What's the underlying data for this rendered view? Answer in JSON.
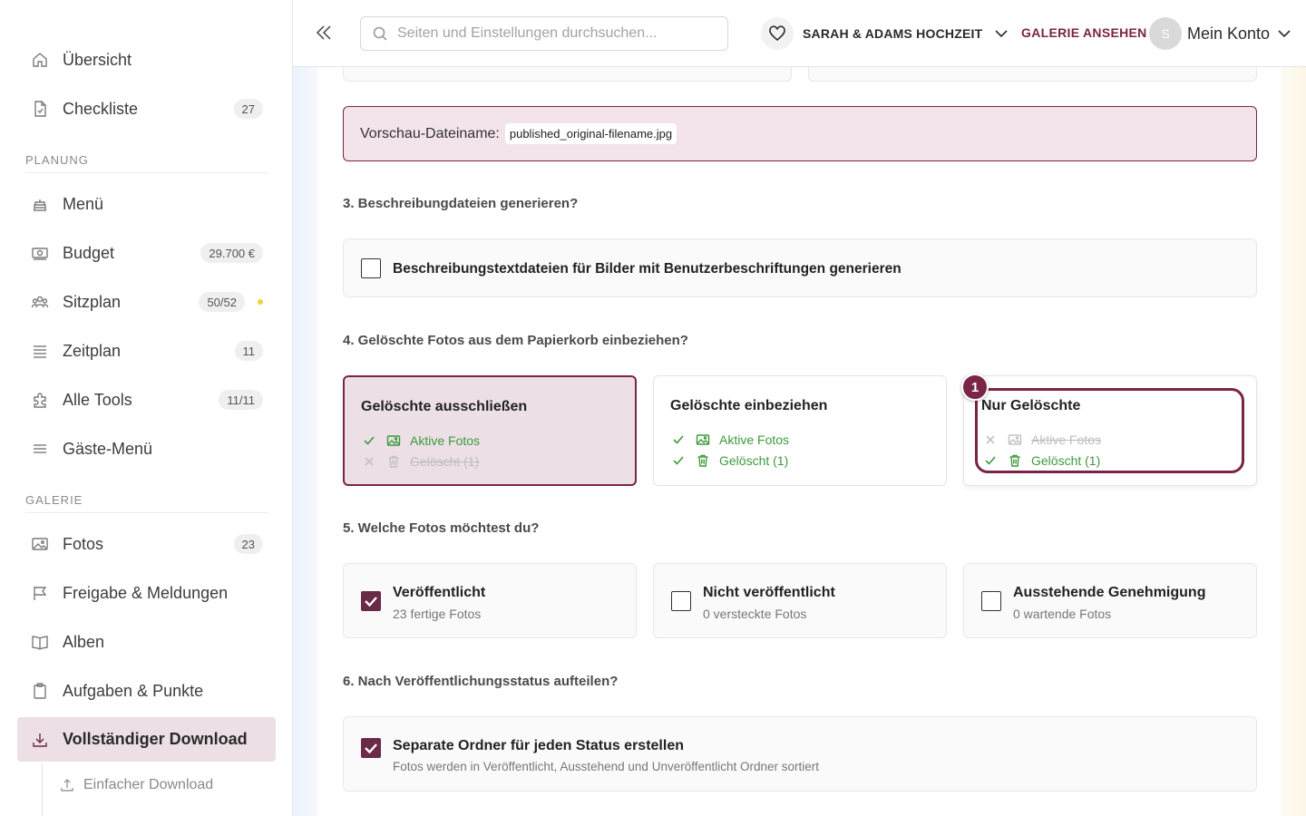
{
  "sidebar": {
    "items": [
      {
        "label": "Übersicht"
      },
      {
        "label": "Checkliste",
        "badge": "27"
      },
      {
        "label": "Menü"
      },
      {
        "label": "Budget",
        "badge": "29.700 €"
      },
      {
        "label": "Sitzplan",
        "badge": "50/52"
      },
      {
        "label": "Zeitplan",
        "badge": "11"
      },
      {
        "label": "Alle Tools",
        "badge": "11/11"
      },
      {
        "label": "Gäste-Menü"
      },
      {
        "label": "Fotos",
        "badge": "23"
      },
      {
        "label": "Freigabe & Meldungen"
      },
      {
        "label": "Alben"
      },
      {
        "label": "Aufgaben & Punkte"
      },
      {
        "label": "Vollständiger Download"
      }
    ],
    "sections": {
      "planung": "PLANUNG",
      "galerie": "GALERIE"
    },
    "sub_item": "Einfacher Download",
    "status_dot_color": "#f1d230"
  },
  "topbar": {
    "search_placeholder": "Seiten und Einstellungen durchsuchen...",
    "event_name": "SARAH & ADAMS HOCHZEIT",
    "view_gallery": "GALERIE ANSEHEN",
    "avatar_initial": "S",
    "account": "Mein Konto"
  },
  "preview": {
    "label": "Vorschau-Dateiname:",
    "filename": "published_original-filename.jpg"
  },
  "q3": {
    "title": "3. Beschreibungdateien generieren?",
    "option": "Beschreibungstextdateien für Bilder mit Benutzerbeschriftungen generieren"
  },
  "q4": {
    "title": "4. Gelöschte Fotos aus dem Papierkorb einbeziehen?",
    "options": [
      {
        "title": "Gelöschte ausschließen",
        "active": "Aktive Fotos",
        "deleted": "Gelöscht (1)"
      },
      {
        "title": "Gelöschte einbeziehen",
        "active": "Aktive Fotos",
        "deleted": "Gelöscht (1)"
      },
      {
        "title": "Nur Gelöschte",
        "active": "Aktive Fotos",
        "deleted": "Gelöscht (1)"
      }
    ],
    "step": "1"
  },
  "q5": {
    "title": "5. Welche Fotos möchtest du?",
    "options": [
      {
        "title": "Veröffentlicht",
        "sub": "23 fertige Fotos"
      },
      {
        "title": "Nicht veröffentlicht",
        "sub": "0 versteckte Fotos"
      },
      {
        "title": "Ausstehende Genehmigung",
        "sub": "0 wartende Fotos"
      }
    ]
  },
  "q6": {
    "title": "6. Nach Veröffentlichungsstatus aufteilen?",
    "option_title": "Separate Ordner für jeden Status erstellen",
    "option_sub": "Fotos werden in Veröffentlicht, Ausstehend und Unveröffentlicht Ordner sortiert"
  },
  "colors": {
    "accent": "#7a2447",
    "accent_light": "#ecdfe5",
    "success": "#3d9a3d"
  }
}
